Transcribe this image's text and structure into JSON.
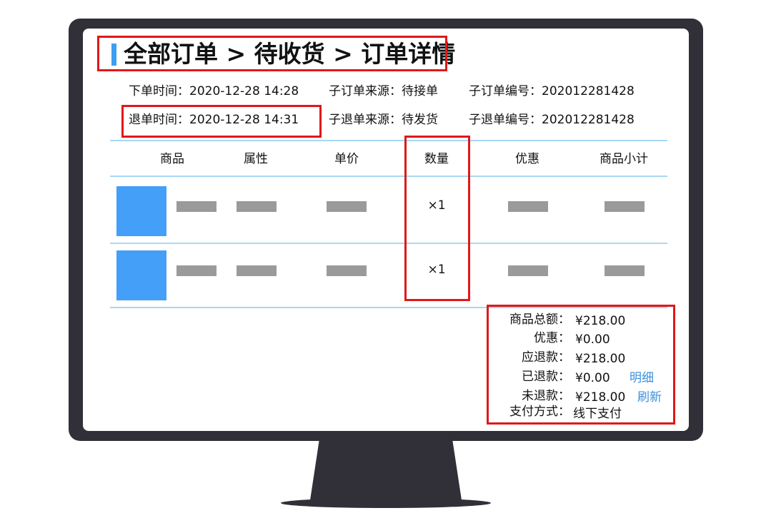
{
  "breadcrumb": {
    "text": "全部订单 > 待收货 > 订单详情"
  },
  "info": {
    "order_time": {
      "label": "下单时间：",
      "value": "2020-12-28 14:28"
    },
    "sub_order_source": {
      "label": "子订单来源：",
      "value": "待接单"
    },
    "sub_order_no": {
      "label": "子订单编号：",
      "value": "202012281428"
    },
    "refund_time": {
      "label": "退单时间：",
      "value": "2020-12-28 14:31"
    },
    "sub_refund_source": {
      "label": "子退单来源：",
      "value": "待发货"
    },
    "sub_refund_no": {
      "label": "子退单编号：",
      "value": "202012281428"
    }
  },
  "table": {
    "columns": [
      "商品",
      "属性",
      "单价",
      "数量",
      "优惠",
      "商品小计"
    ],
    "rows": [
      {
        "quantity": "×1"
      },
      {
        "quantity": "×1"
      }
    ]
  },
  "summary": {
    "goods_total": {
      "label": "商品总额：",
      "value": "¥218.00"
    },
    "discount": {
      "label": "优惠：",
      "value": "¥0.00"
    },
    "refund_due": {
      "label": "应退款：",
      "value": "¥218.00"
    },
    "refunded": {
      "label": "已退款：",
      "value": "¥0.00",
      "link": "明细"
    },
    "unrefunded": {
      "label": "未退款：",
      "value": "¥218.00",
      "link": "刷新"
    },
    "payment_method": {
      "label": "支付方式：",
      "value": "线下支付"
    }
  },
  "colors": {
    "accent": "#3d9df3",
    "highlight": "#e01818",
    "divider": "#a8d8f5",
    "thumb": "#449ff9",
    "link": "#3b8fdd"
  }
}
